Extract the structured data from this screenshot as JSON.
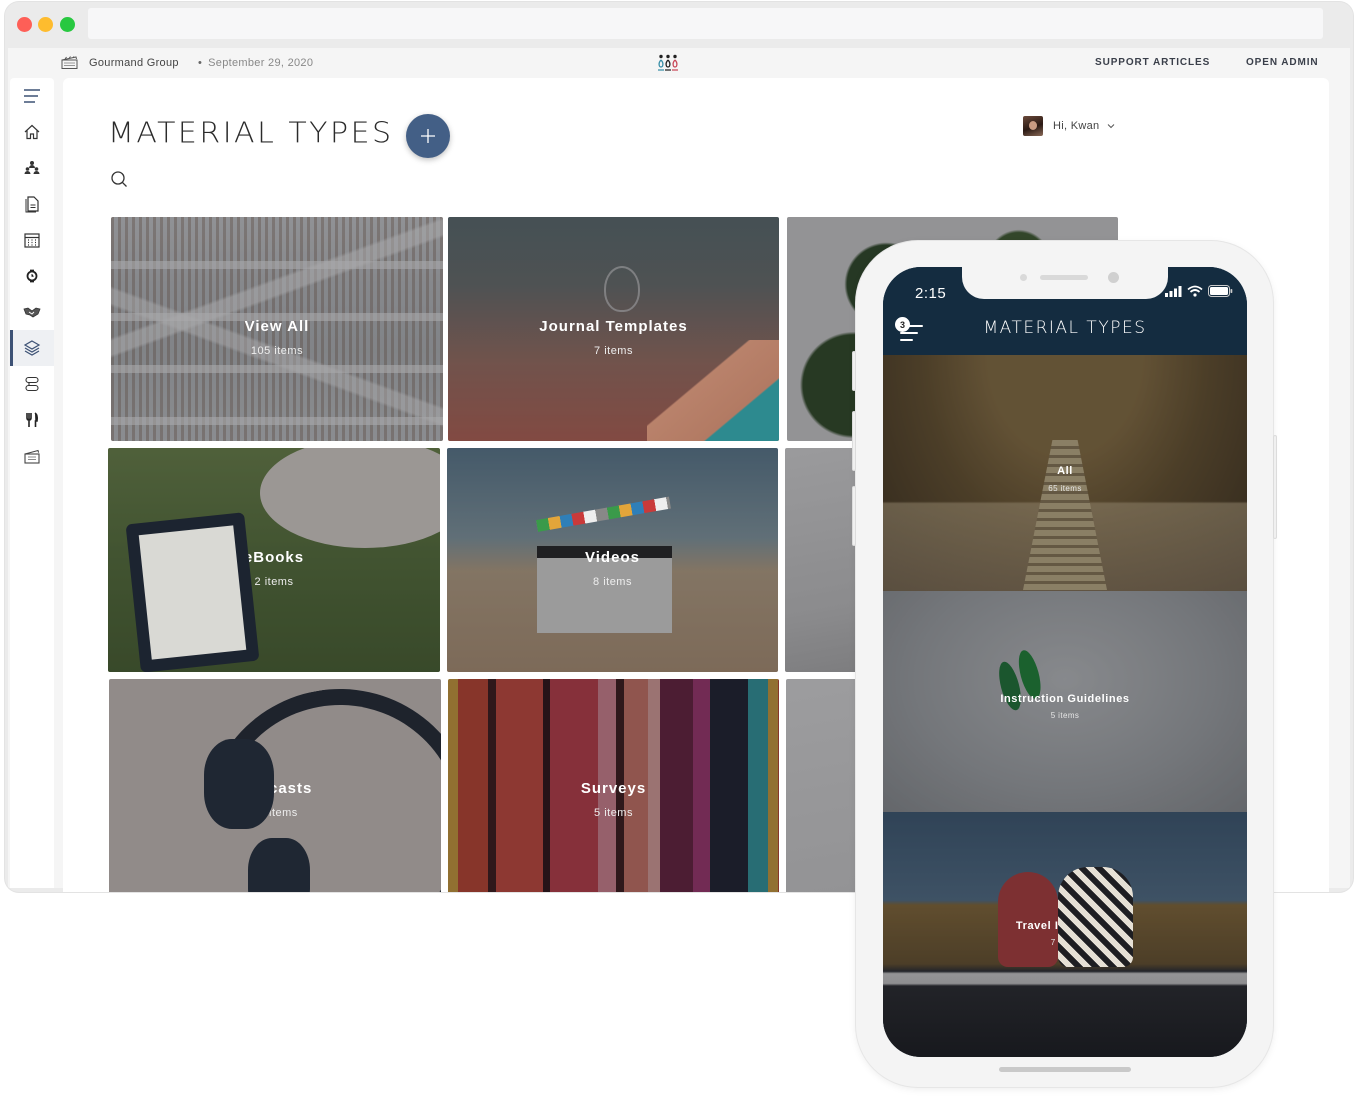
{
  "browser": {
    "url": ""
  },
  "topbar": {
    "org_icon": "clapperboard-icon",
    "org_name": "Gourmand Group",
    "date": "September 29, 2020",
    "logo": "three-people-logo",
    "links": [
      {
        "label": "SUPPORT ARTICLES"
      },
      {
        "label": "OPEN ADMIN"
      }
    ]
  },
  "sidebar": {
    "items": [
      {
        "icon": "menu-icon",
        "active": false
      },
      {
        "icon": "home-icon",
        "active": false
      },
      {
        "icon": "team-icon",
        "active": false
      },
      {
        "icon": "documents-icon",
        "active": false
      },
      {
        "icon": "calendar-icon",
        "active": false
      },
      {
        "icon": "watch-icon",
        "active": false
      },
      {
        "icon": "handshake-icon",
        "active": false
      },
      {
        "icon": "layers-icon",
        "active": true
      },
      {
        "icon": "flow-icon",
        "active": false
      },
      {
        "icon": "fork-knife-icon",
        "active": false
      },
      {
        "icon": "clapperboard-icon",
        "active": false
      }
    ]
  },
  "header": {
    "title": "MATERIAL TYPES",
    "add_icon": "plus-icon",
    "search_icon": "search-icon",
    "user_greeting": "Hi, Kwan",
    "accent": "#435f86"
  },
  "tiles": [
    {
      "name": "View All",
      "count": "105 items"
    },
    {
      "name": "Journal Templates",
      "count": "7 items"
    },
    {
      "name": "",
      "count": ""
    },
    {
      "name": "eBooks",
      "count": "2 items"
    },
    {
      "name": "Videos",
      "count": "8 items"
    },
    {
      "name": "",
      "count": ""
    },
    {
      "name": "Podcasts",
      "count": "17 items"
    },
    {
      "name": "Surveys",
      "count": "5 items"
    },
    {
      "name": "",
      "count": ""
    }
  ],
  "phone": {
    "time": "2:15",
    "menu_badge": "3",
    "title": "MATERIAL TYPES",
    "header_color": "#142c40",
    "tiles": [
      {
        "name": "All",
        "count": "65 items"
      },
      {
        "name": "Instruction Guidelines",
        "count": "5 items"
      },
      {
        "name": "Travel Itineraries",
        "count": "7 items"
      }
    ]
  }
}
